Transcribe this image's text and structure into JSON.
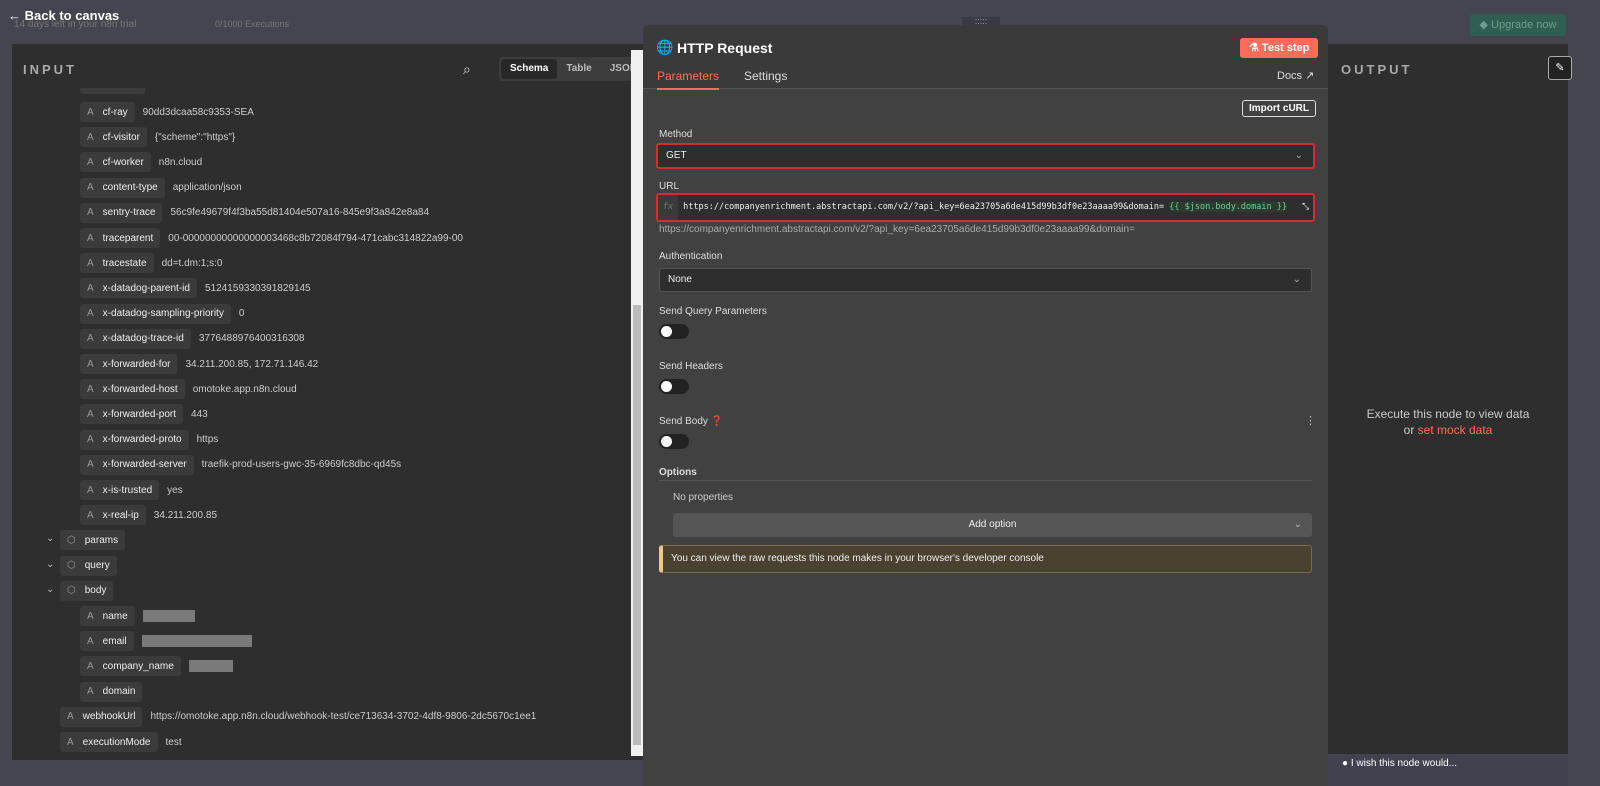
{
  "top": {
    "back": "Back to canvas",
    "trial": "14 days left in your n8n trial",
    "executions": "0/1000 Executions",
    "upgrade": "Upgrade now"
  },
  "input": {
    "title": "INPUT",
    "tabs": [
      "Schema",
      "Table",
      "JSON"
    ],
    "rows": [
      {
        "k": "cf-ray",
        "v": "90dd3dcaa58c9353-SEA",
        "lvl": 2
      },
      {
        "k": "cf-visitor",
        "v": "{\"scheme\":\"https\"}",
        "lvl": 2
      },
      {
        "k": "cf-worker",
        "v": "n8n.cloud",
        "lvl": 2
      },
      {
        "k": "content-type",
        "v": "application/json",
        "lvl": 2
      },
      {
        "k": "sentry-trace",
        "v": "56c9fe49679f4f3ba55d81404e507a16-845e9f3a842e8a84",
        "lvl": 2
      },
      {
        "k": "traceparent",
        "v": "00-00000000000000003468c8b72084f794-471cabc314822a99-00",
        "lvl": 2
      },
      {
        "k": "tracestate",
        "v": "dd=t.dm:1;s:0",
        "lvl": 2
      },
      {
        "k": "x-datadog-parent-id",
        "v": "5124159330391829145",
        "lvl": 2
      },
      {
        "k": "x-datadog-sampling-priority",
        "v": "0",
        "lvl": 2
      },
      {
        "k": "x-datadog-trace-id",
        "v": "3776488976400316308",
        "lvl": 2
      },
      {
        "k": "x-forwarded-for",
        "v": "34.211.200.85, 172.71.146.42",
        "lvl": 2
      },
      {
        "k": "x-forwarded-host",
        "v": "omotoke.app.n8n.cloud",
        "lvl": 2
      },
      {
        "k": "x-forwarded-port",
        "v": "443",
        "lvl": 2
      },
      {
        "k": "x-forwarded-proto",
        "v": "https",
        "lvl": 2
      },
      {
        "k": "x-forwarded-server",
        "v": "traefik-prod-users-gwc-35-6969fc8dbc-qd45s",
        "lvl": 2
      },
      {
        "k": "x-is-trusted",
        "v": "yes",
        "lvl": 2
      },
      {
        "k": "x-real-ip",
        "v": "34.211.200.85",
        "lvl": 2
      },
      {
        "k": "params",
        "v": "",
        "lvl": 1,
        "obj": true
      },
      {
        "k": "query",
        "v": "",
        "lvl": 1,
        "obj": true
      },
      {
        "k": "body",
        "v": "",
        "lvl": 1,
        "obj": true
      },
      {
        "k": "name",
        "v": "",
        "lvl": 2,
        "blur": 52
      },
      {
        "k": "email",
        "v": "",
        "lvl": 2,
        "blur": 110
      },
      {
        "k": "company_name",
        "v": "",
        "lvl": 2,
        "blur": 44
      },
      {
        "k": "domain",
        "v": "",
        "lvl": 2
      },
      {
        "k": "webhookUrl",
        "v": "https://omotoke.app.n8n.cloud/webhook-test/ce713634-3702-4df8-9806-2dc5670c1ee1",
        "lvl": 1
      },
      {
        "k": "executionMode",
        "v": "test",
        "lvl": 1
      }
    ]
  },
  "node": {
    "title": "HTTP Request",
    "test": "Test step",
    "tabs": [
      "Parameters",
      "Settings"
    ],
    "docs": "Docs",
    "import": "Import cURL",
    "method_label": "Method",
    "method": "GET",
    "url_label": "URL",
    "url": "https://companyenrichment.abstractapi.com/v2/?api_key=6ea23705a6de415d99b3df0e23aaaa99&domain= ",
    "url_expr": "{{ $json.body.domain }}",
    "url_preview": "https://companyenrichment.abstractapi.com/v2/?api_key=6ea23705a6de415d99b3df0e23aaaa99&domain=",
    "auth_label": "Authentication",
    "auth": "None",
    "query_label": "Send Query Parameters",
    "headers_label": "Send Headers",
    "body_label": "Send Body",
    "options_label": "Options",
    "no_props": "No properties",
    "add_option": "Add option",
    "notice": "You can view the raw requests this node makes in your browser's developer console"
  },
  "output": {
    "title": "OUTPUT",
    "msg": "Execute this node to view data",
    "or": "or",
    "mock": "set mock data",
    "wish": "I wish this node would..."
  },
  "colors": {
    "accent": "#ff6d5a",
    "red": "#d62c2c"
  }
}
